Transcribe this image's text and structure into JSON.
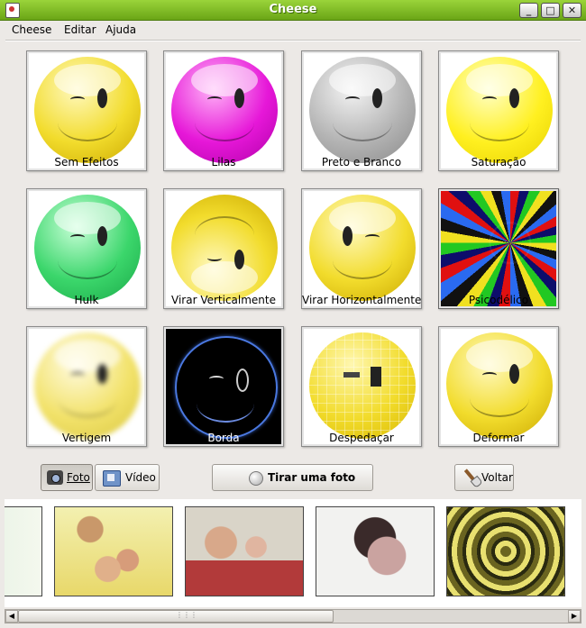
{
  "window": {
    "title": "Cheese"
  },
  "menu": [
    {
      "label": "Cheese"
    },
    {
      "label": "Editar"
    },
    {
      "label": "Ajuda"
    }
  ],
  "effects": [
    {
      "label": "Sem Efeitos",
      "color": "#f2dc2c"
    },
    {
      "label": "Lilas",
      "color": "#e617d8"
    },
    {
      "label": "Preto e Branco",
      "color": "#b4b4b4"
    },
    {
      "label": "Saturação",
      "color": "#fff020"
    },
    {
      "label": "Hulk",
      "color": "#3bd66b"
    },
    {
      "label": "Virar Verticalmente",
      "color": "#f2dc2c"
    },
    {
      "label": "Virar Horizontalmente",
      "color": "#f2dc2c"
    },
    {
      "label": "Psicodélico",
      "color": "psychedelic"
    },
    {
      "label": "Vertigem",
      "color": "#f2e26a"
    },
    {
      "label": "Borda",
      "color": "#000000"
    },
    {
      "label": "Despedaçar",
      "color": "#f2dc2c"
    },
    {
      "label": "Deformar",
      "color": "#f2dc2c"
    }
  ],
  "buttons": {
    "photo": "Foto",
    "video": "Vídeo",
    "take_photo": "Tirar uma foto",
    "back": "Voltar"
  },
  "gallery_count": 5
}
